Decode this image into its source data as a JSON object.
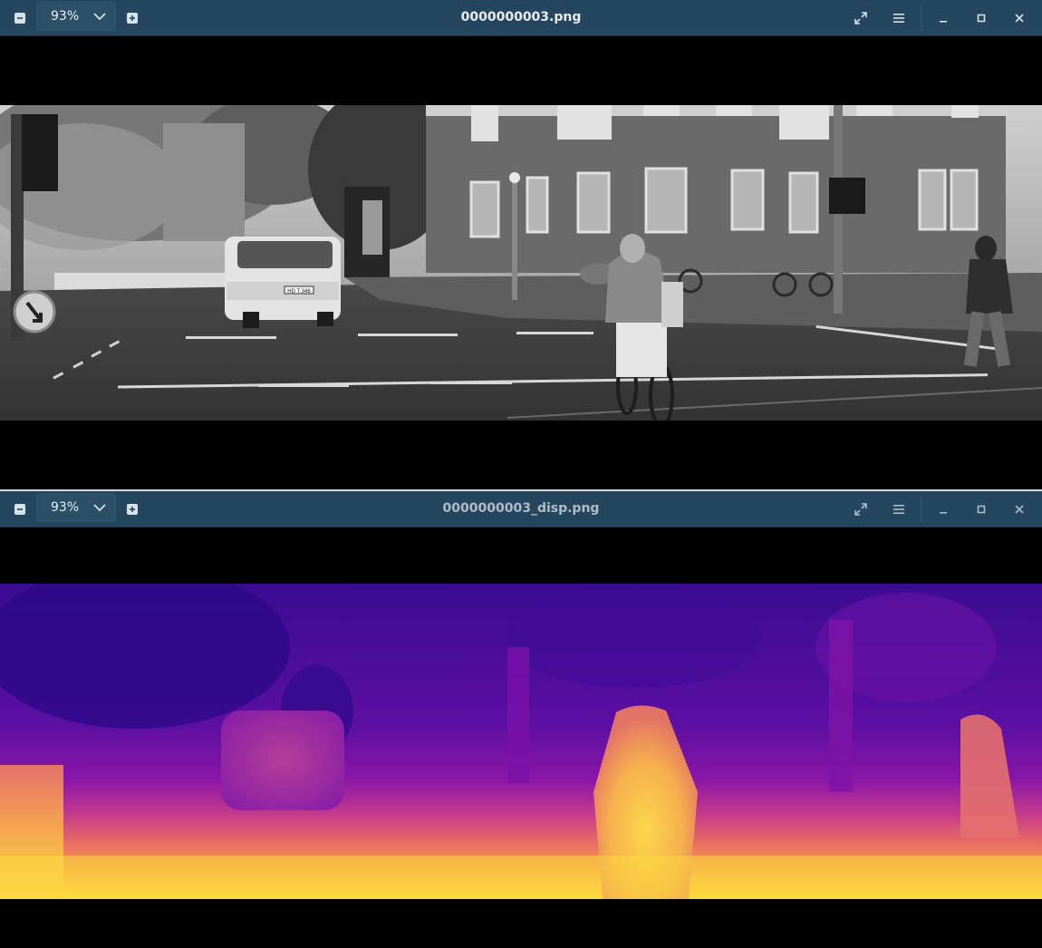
{
  "windows": [
    {
      "title": "0000000003.png",
      "zoom": "93%",
      "image": {
        "kind": "grayscale street photo",
        "plate_text": "HD T 346"
      }
    },
    {
      "title": "0000000003_disp.png",
      "zoom": "93%",
      "image": {
        "kind": "disparity map",
        "colormap": [
          "#1e0a78",
          "#4a0c9a",
          "#7c12a8",
          "#b22fa0",
          "#e05a74",
          "#f79a4a",
          "#fce03a"
        ]
      }
    }
  ],
  "controls": {
    "zoom_out_icon": "minus-square-icon",
    "zoom_in_icon": "plus-square-icon",
    "zoom_dropdown_icon": "chevron-down-icon",
    "fullscreen_icon": "expand-arrows-icon",
    "menu_icon": "hamburger-menu-icon",
    "minimize_icon": "minimize-icon",
    "maximize_icon": "maximize-icon",
    "close_icon": "close-icon"
  },
  "colors": {
    "titlebar": "#24465f",
    "titlebar_text": "#e8eef2",
    "inactive_title_text": "#aebcc6",
    "background": "#000000"
  }
}
